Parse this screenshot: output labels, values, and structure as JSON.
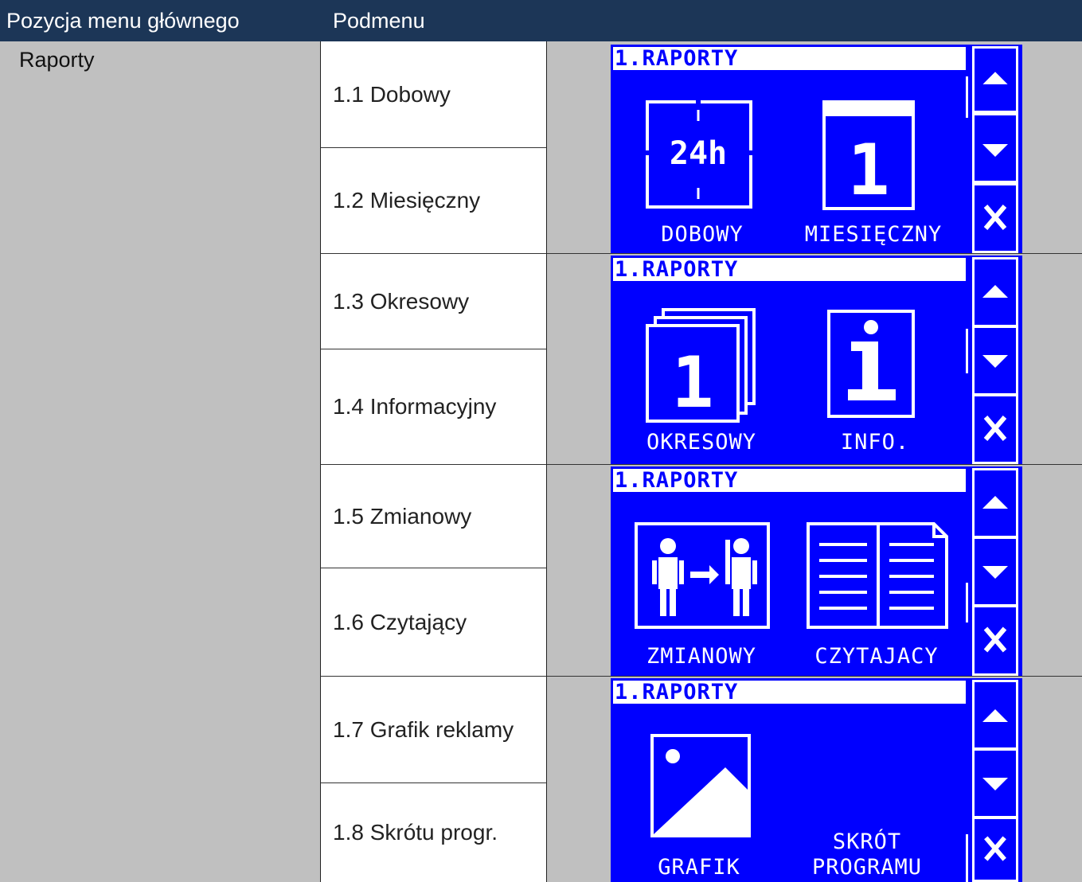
{
  "table": {
    "headers": [
      "Pozycja menu głównego",
      "Podmenu"
    ],
    "main_item": "Raporty",
    "submenu": [
      "1.1 Dobowy",
      "1.2 Miesięczny",
      "1.3 Okresowy",
      "1.4 Informacyjny",
      "1.5 Zmianowy",
      "1.6 Czytający",
      "1.7 Grafik reklamy",
      "1.8 Skrótu progr."
    ]
  },
  "screens": [
    {
      "title": "1.RAPORTY",
      "left_label": "DOBOWY",
      "right_label": "MIESIĘCZNY",
      "left_icon": "clock-24h-icon",
      "right_icon": "calendar-day-1-icon",
      "clock_text": "24h",
      "calendar_text": "1"
    },
    {
      "title": "1.RAPORTY",
      "left_label": "OKRESOWY",
      "right_label": "INFO.",
      "left_icon": "calendar-stack-icon",
      "right_icon": "info-icon",
      "calendar_text": "1",
      "info_text": "i"
    },
    {
      "title": "1.RAPORTY",
      "left_label": "ZMIANOWY",
      "right_label": "CZYTAJACY",
      "left_icon": "shift-change-icon",
      "right_icon": "open-book-icon"
    },
    {
      "title": "1.RAPORTY",
      "left_label": "GRAFIK",
      "right_label_line1": "SKRÓT",
      "right_label_line2": "PROGRAMU",
      "left_icon": "image-icon"
    }
  ],
  "colors": {
    "header_bg": "#1c3657",
    "lcd_blue": "#0000ff",
    "cell_gray": "#c0c0c0"
  }
}
